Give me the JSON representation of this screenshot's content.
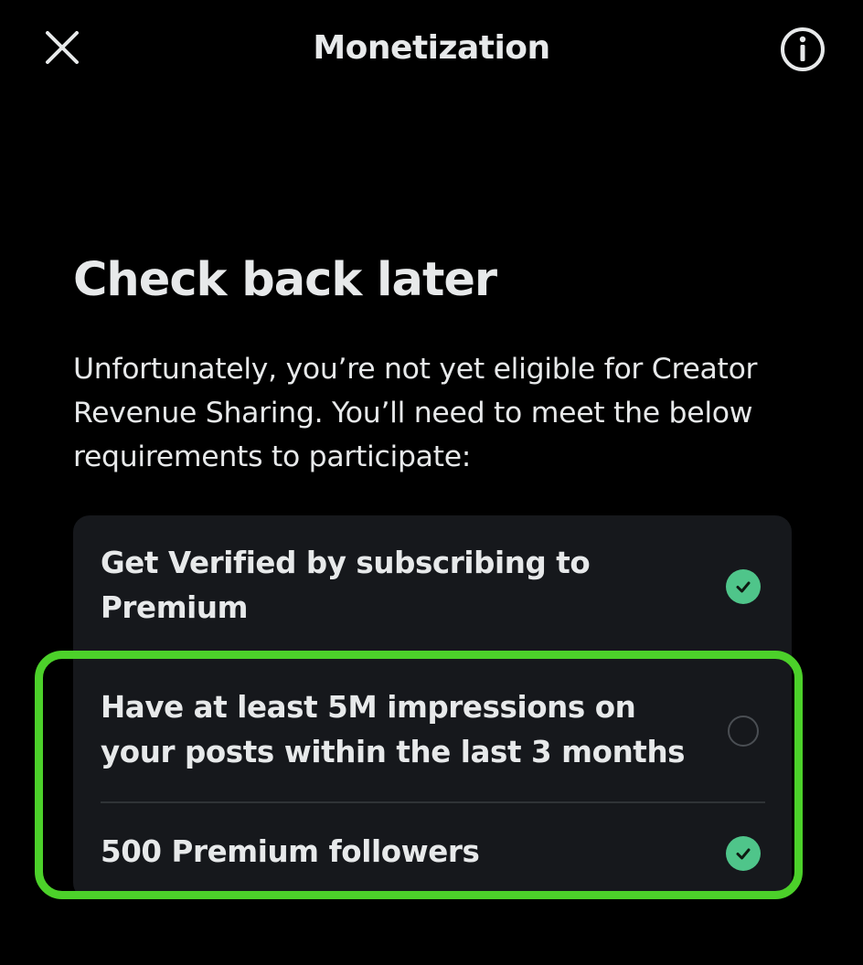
{
  "header": {
    "title": "Monetization",
    "close_icon": "close-icon",
    "info_icon": "info-icon"
  },
  "main": {
    "heading": "Check back later",
    "description": "Unfortunately, you’re not yet eligible for Creator Revenue Sharing. You’ll need to meet the below requirements to participate:"
  },
  "requirements": [
    {
      "label": "Get Verified by subscribing to Premium",
      "met": true
    },
    {
      "label": "Have at least 5M impressions on your posts within the last 3 months",
      "met": false
    },
    {
      "label": "500 Premium followers",
      "met": true
    }
  ],
  "colors": {
    "background": "#000000",
    "text": "#e7e9ea",
    "card": "#16181c",
    "check": "#4fc58a",
    "highlight": "#4cd12a"
  }
}
